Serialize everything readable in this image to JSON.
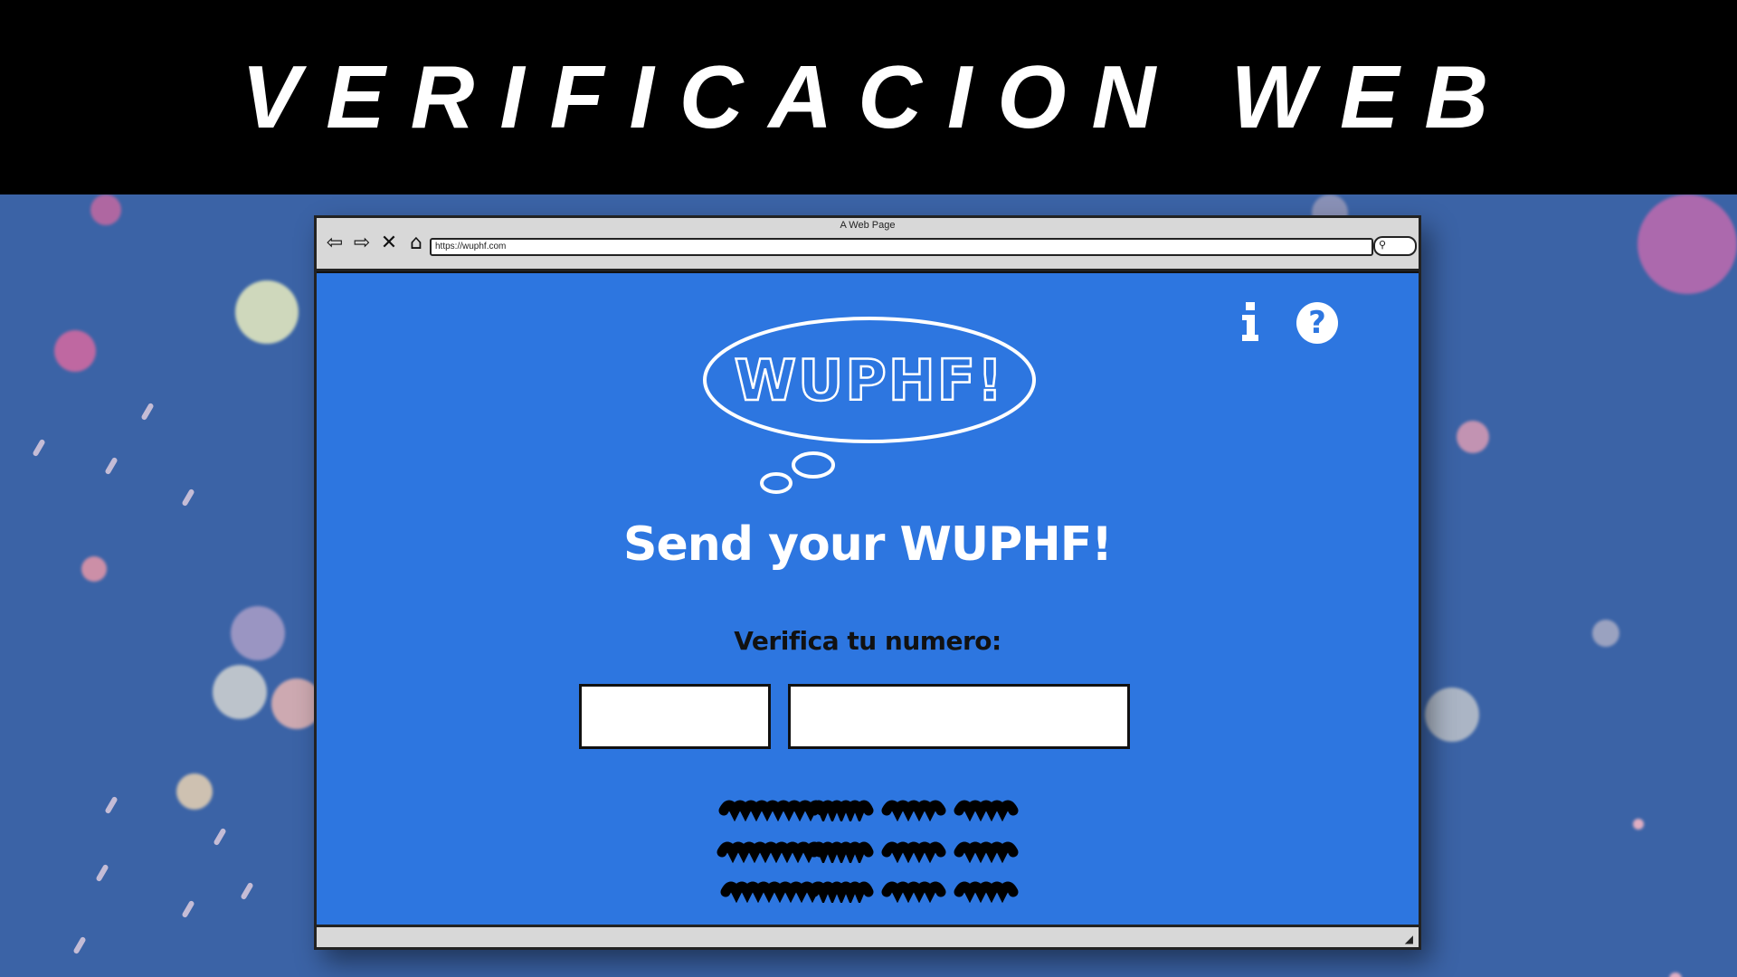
{
  "banner": {
    "title": "VERIFICACION WEB"
  },
  "browser": {
    "window_title": "A Web Page",
    "url": "https://wuphf.com",
    "nav_icons": [
      "back-arrow-icon",
      "forward-arrow-icon",
      "stop-icon",
      "home-icon"
    ]
  },
  "page": {
    "logo_text": "WUPHF!",
    "headline": "Send your WUPHF!",
    "verify_label": "Verifica tu numero:",
    "icons": {
      "info": "info-icon",
      "help": "help-icon",
      "help_glyph": "?"
    },
    "inputs": {
      "country_code": {
        "value": "",
        "placeholder": ""
      },
      "phone_number": {
        "value": "",
        "placeholder": ""
      }
    },
    "placeholder_text_lines": 3
  },
  "colors": {
    "page_blue": "#2d76e0",
    "background_blue": "#3b63a6",
    "banner_black": "#000000",
    "chrome_gray": "#d8d8d8"
  }
}
